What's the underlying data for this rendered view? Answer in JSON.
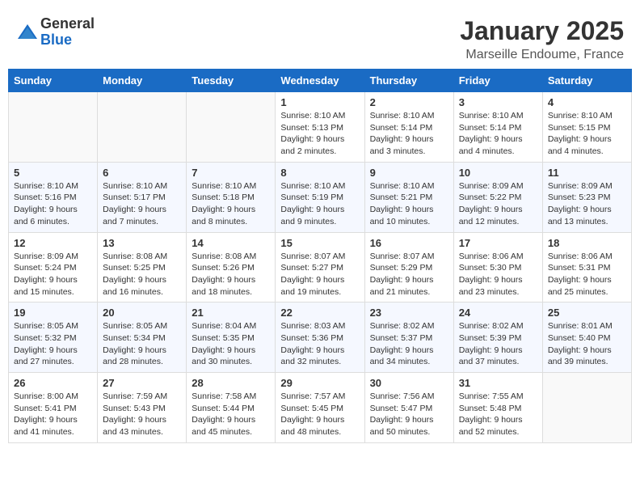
{
  "logo": {
    "general": "General",
    "blue": "Blue"
  },
  "header": {
    "month": "January 2025",
    "location": "Marseille Endoume, France"
  },
  "weekdays": [
    "Sunday",
    "Monday",
    "Tuesday",
    "Wednesday",
    "Thursday",
    "Friday",
    "Saturday"
  ],
  "weeks": [
    [
      {
        "day": "",
        "info": ""
      },
      {
        "day": "",
        "info": ""
      },
      {
        "day": "",
        "info": ""
      },
      {
        "day": "1",
        "info": "Sunrise: 8:10 AM\nSunset: 5:13 PM\nDaylight: 9 hours\nand 2 minutes."
      },
      {
        "day": "2",
        "info": "Sunrise: 8:10 AM\nSunset: 5:14 PM\nDaylight: 9 hours\nand 3 minutes."
      },
      {
        "day": "3",
        "info": "Sunrise: 8:10 AM\nSunset: 5:14 PM\nDaylight: 9 hours\nand 4 minutes."
      },
      {
        "day": "4",
        "info": "Sunrise: 8:10 AM\nSunset: 5:15 PM\nDaylight: 9 hours\nand 4 minutes."
      }
    ],
    [
      {
        "day": "5",
        "info": "Sunrise: 8:10 AM\nSunset: 5:16 PM\nDaylight: 9 hours\nand 6 minutes."
      },
      {
        "day": "6",
        "info": "Sunrise: 8:10 AM\nSunset: 5:17 PM\nDaylight: 9 hours\nand 7 minutes."
      },
      {
        "day": "7",
        "info": "Sunrise: 8:10 AM\nSunset: 5:18 PM\nDaylight: 9 hours\nand 8 minutes."
      },
      {
        "day": "8",
        "info": "Sunrise: 8:10 AM\nSunset: 5:19 PM\nDaylight: 9 hours\nand 9 minutes."
      },
      {
        "day": "9",
        "info": "Sunrise: 8:10 AM\nSunset: 5:21 PM\nDaylight: 9 hours\nand 10 minutes."
      },
      {
        "day": "10",
        "info": "Sunrise: 8:09 AM\nSunset: 5:22 PM\nDaylight: 9 hours\nand 12 minutes."
      },
      {
        "day": "11",
        "info": "Sunrise: 8:09 AM\nSunset: 5:23 PM\nDaylight: 9 hours\nand 13 minutes."
      }
    ],
    [
      {
        "day": "12",
        "info": "Sunrise: 8:09 AM\nSunset: 5:24 PM\nDaylight: 9 hours\nand 15 minutes."
      },
      {
        "day": "13",
        "info": "Sunrise: 8:08 AM\nSunset: 5:25 PM\nDaylight: 9 hours\nand 16 minutes."
      },
      {
        "day": "14",
        "info": "Sunrise: 8:08 AM\nSunset: 5:26 PM\nDaylight: 9 hours\nand 18 minutes."
      },
      {
        "day": "15",
        "info": "Sunrise: 8:07 AM\nSunset: 5:27 PM\nDaylight: 9 hours\nand 19 minutes."
      },
      {
        "day": "16",
        "info": "Sunrise: 8:07 AM\nSunset: 5:29 PM\nDaylight: 9 hours\nand 21 minutes."
      },
      {
        "day": "17",
        "info": "Sunrise: 8:06 AM\nSunset: 5:30 PM\nDaylight: 9 hours\nand 23 minutes."
      },
      {
        "day": "18",
        "info": "Sunrise: 8:06 AM\nSunset: 5:31 PM\nDaylight: 9 hours\nand 25 minutes."
      }
    ],
    [
      {
        "day": "19",
        "info": "Sunrise: 8:05 AM\nSunset: 5:32 PM\nDaylight: 9 hours\nand 27 minutes."
      },
      {
        "day": "20",
        "info": "Sunrise: 8:05 AM\nSunset: 5:34 PM\nDaylight: 9 hours\nand 28 minutes."
      },
      {
        "day": "21",
        "info": "Sunrise: 8:04 AM\nSunset: 5:35 PM\nDaylight: 9 hours\nand 30 minutes."
      },
      {
        "day": "22",
        "info": "Sunrise: 8:03 AM\nSunset: 5:36 PM\nDaylight: 9 hours\nand 32 minutes."
      },
      {
        "day": "23",
        "info": "Sunrise: 8:02 AM\nSunset: 5:37 PM\nDaylight: 9 hours\nand 34 minutes."
      },
      {
        "day": "24",
        "info": "Sunrise: 8:02 AM\nSunset: 5:39 PM\nDaylight: 9 hours\nand 37 minutes."
      },
      {
        "day": "25",
        "info": "Sunrise: 8:01 AM\nSunset: 5:40 PM\nDaylight: 9 hours\nand 39 minutes."
      }
    ],
    [
      {
        "day": "26",
        "info": "Sunrise: 8:00 AM\nSunset: 5:41 PM\nDaylight: 9 hours\nand 41 minutes."
      },
      {
        "day": "27",
        "info": "Sunrise: 7:59 AM\nSunset: 5:43 PM\nDaylight: 9 hours\nand 43 minutes."
      },
      {
        "day": "28",
        "info": "Sunrise: 7:58 AM\nSunset: 5:44 PM\nDaylight: 9 hours\nand 45 minutes."
      },
      {
        "day": "29",
        "info": "Sunrise: 7:57 AM\nSunset: 5:45 PM\nDaylight: 9 hours\nand 48 minutes."
      },
      {
        "day": "30",
        "info": "Sunrise: 7:56 AM\nSunset: 5:47 PM\nDaylight: 9 hours\nand 50 minutes."
      },
      {
        "day": "31",
        "info": "Sunrise: 7:55 AM\nSunset: 5:48 PM\nDaylight: 9 hours\nand 52 minutes."
      },
      {
        "day": "",
        "info": ""
      }
    ]
  ]
}
